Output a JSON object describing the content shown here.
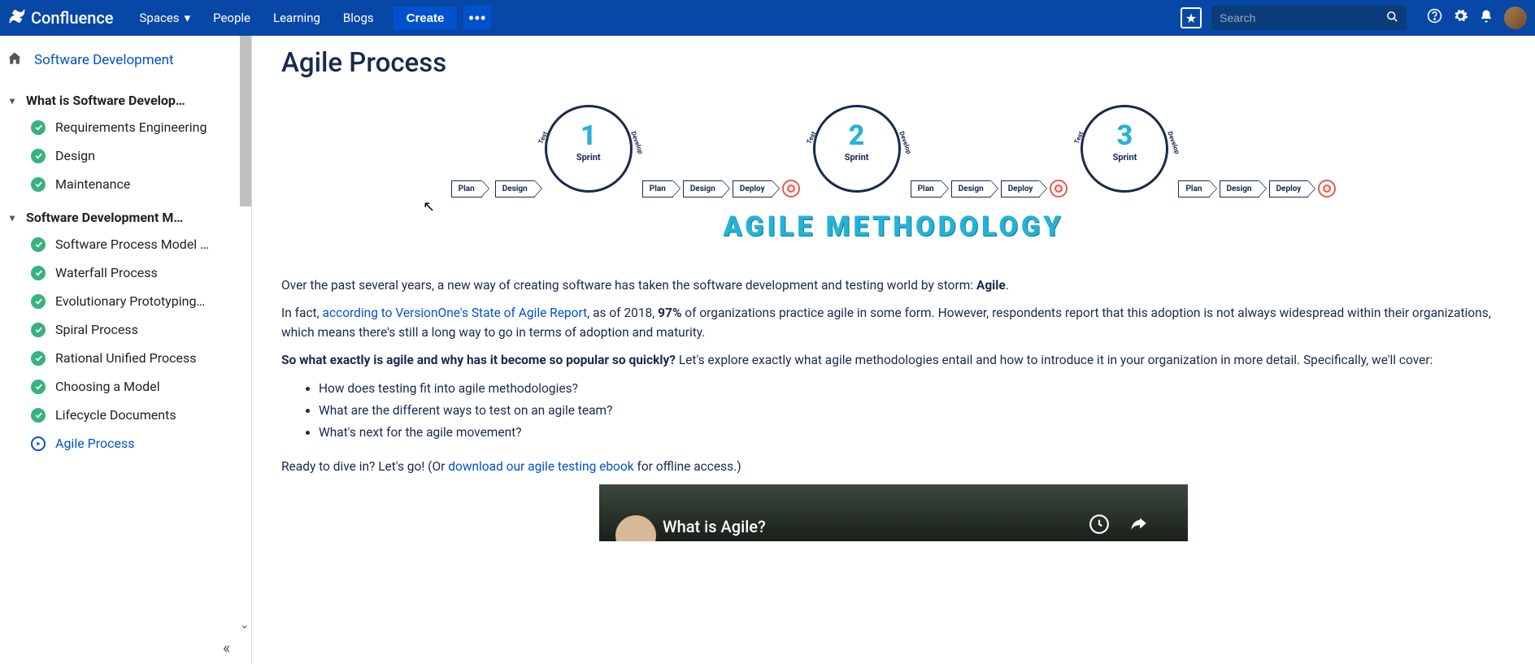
{
  "header": {
    "product": "Confluence",
    "nav": {
      "spaces": "Spaces",
      "people": "People",
      "learning": "Learning",
      "blogs": "Blogs"
    },
    "create": "Create",
    "search_placeholder": "Search"
  },
  "sidebar": {
    "space": "Software Development",
    "section1": {
      "title": "What is Software Develop…",
      "pages": [
        {
          "label": "Requirements Engineering"
        },
        {
          "label": "Design"
        },
        {
          "label": "Maintenance"
        }
      ]
    },
    "section2": {
      "title": "Software Development M…",
      "pages": [
        {
          "label": "Software Process Model …"
        },
        {
          "label": "Waterfall Process"
        },
        {
          "label": "Evolutionary Prototyping…"
        },
        {
          "label": "Spiral Process"
        },
        {
          "label": "Rational Unified Process"
        },
        {
          "label": "Choosing a Model"
        },
        {
          "label": "Lifecycle Documents"
        },
        {
          "label": "Agile Process",
          "current": true
        }
      ]
    }
  },
  "article": {
    "title": "Agile Process",
    "hero": {
      "diagram_title": "AGILE  METHODOLOGY",
      "cycle": {
        "sprint_label": "Sprint",
        "test": "Test",
        "develop": "Develop"
      },
      "sprint_numbers": [
        "1",
        "2",
        "3"
      ],
      "steps": {
        "plan": "Plan",
        "design": "Design",
        "deploy": "Deploy"
      }
    },
    "p1_pre": "Over the past several years, a new way of creating software has taken the software development and testing world by storm: ",
    "p1_bold": "Agile",
    "p1_post": ".",
    "p2_pre": "In fact, ",
    "p2_link": "according to VersionOne's State of Agile Report",
    "p2_mid": ", as of 2018, ",
    "p2_bold": "97%",
    "p2_post": " of organizations practice agile in some form. However, respondents report that this adoption is not always widespread within their organizations, which means there's still a long way to go in terms of adoption and maturity.",
    "p3_bold": "So what exactly is agile and why has it become so popular so quickly?",
    "p3_post": " Let's explore exactly what agile methodologies entail and how to introduce it in your organization in more detail. Specifically, we'll cover:",
    "bullets": [
      "How does testing fit into agile methodologies?",
      "What are the different ways to test on an agile team?",
      "What's next for the agile movement?"
    ],
    "p4_pre": "Ready to dive in? Let's go! (Or ",
    "p4_link": "download our agile testing ebook",
    "p4_post": " for offline access.)",
    "video_title": "What is Agile?"
  }
}
